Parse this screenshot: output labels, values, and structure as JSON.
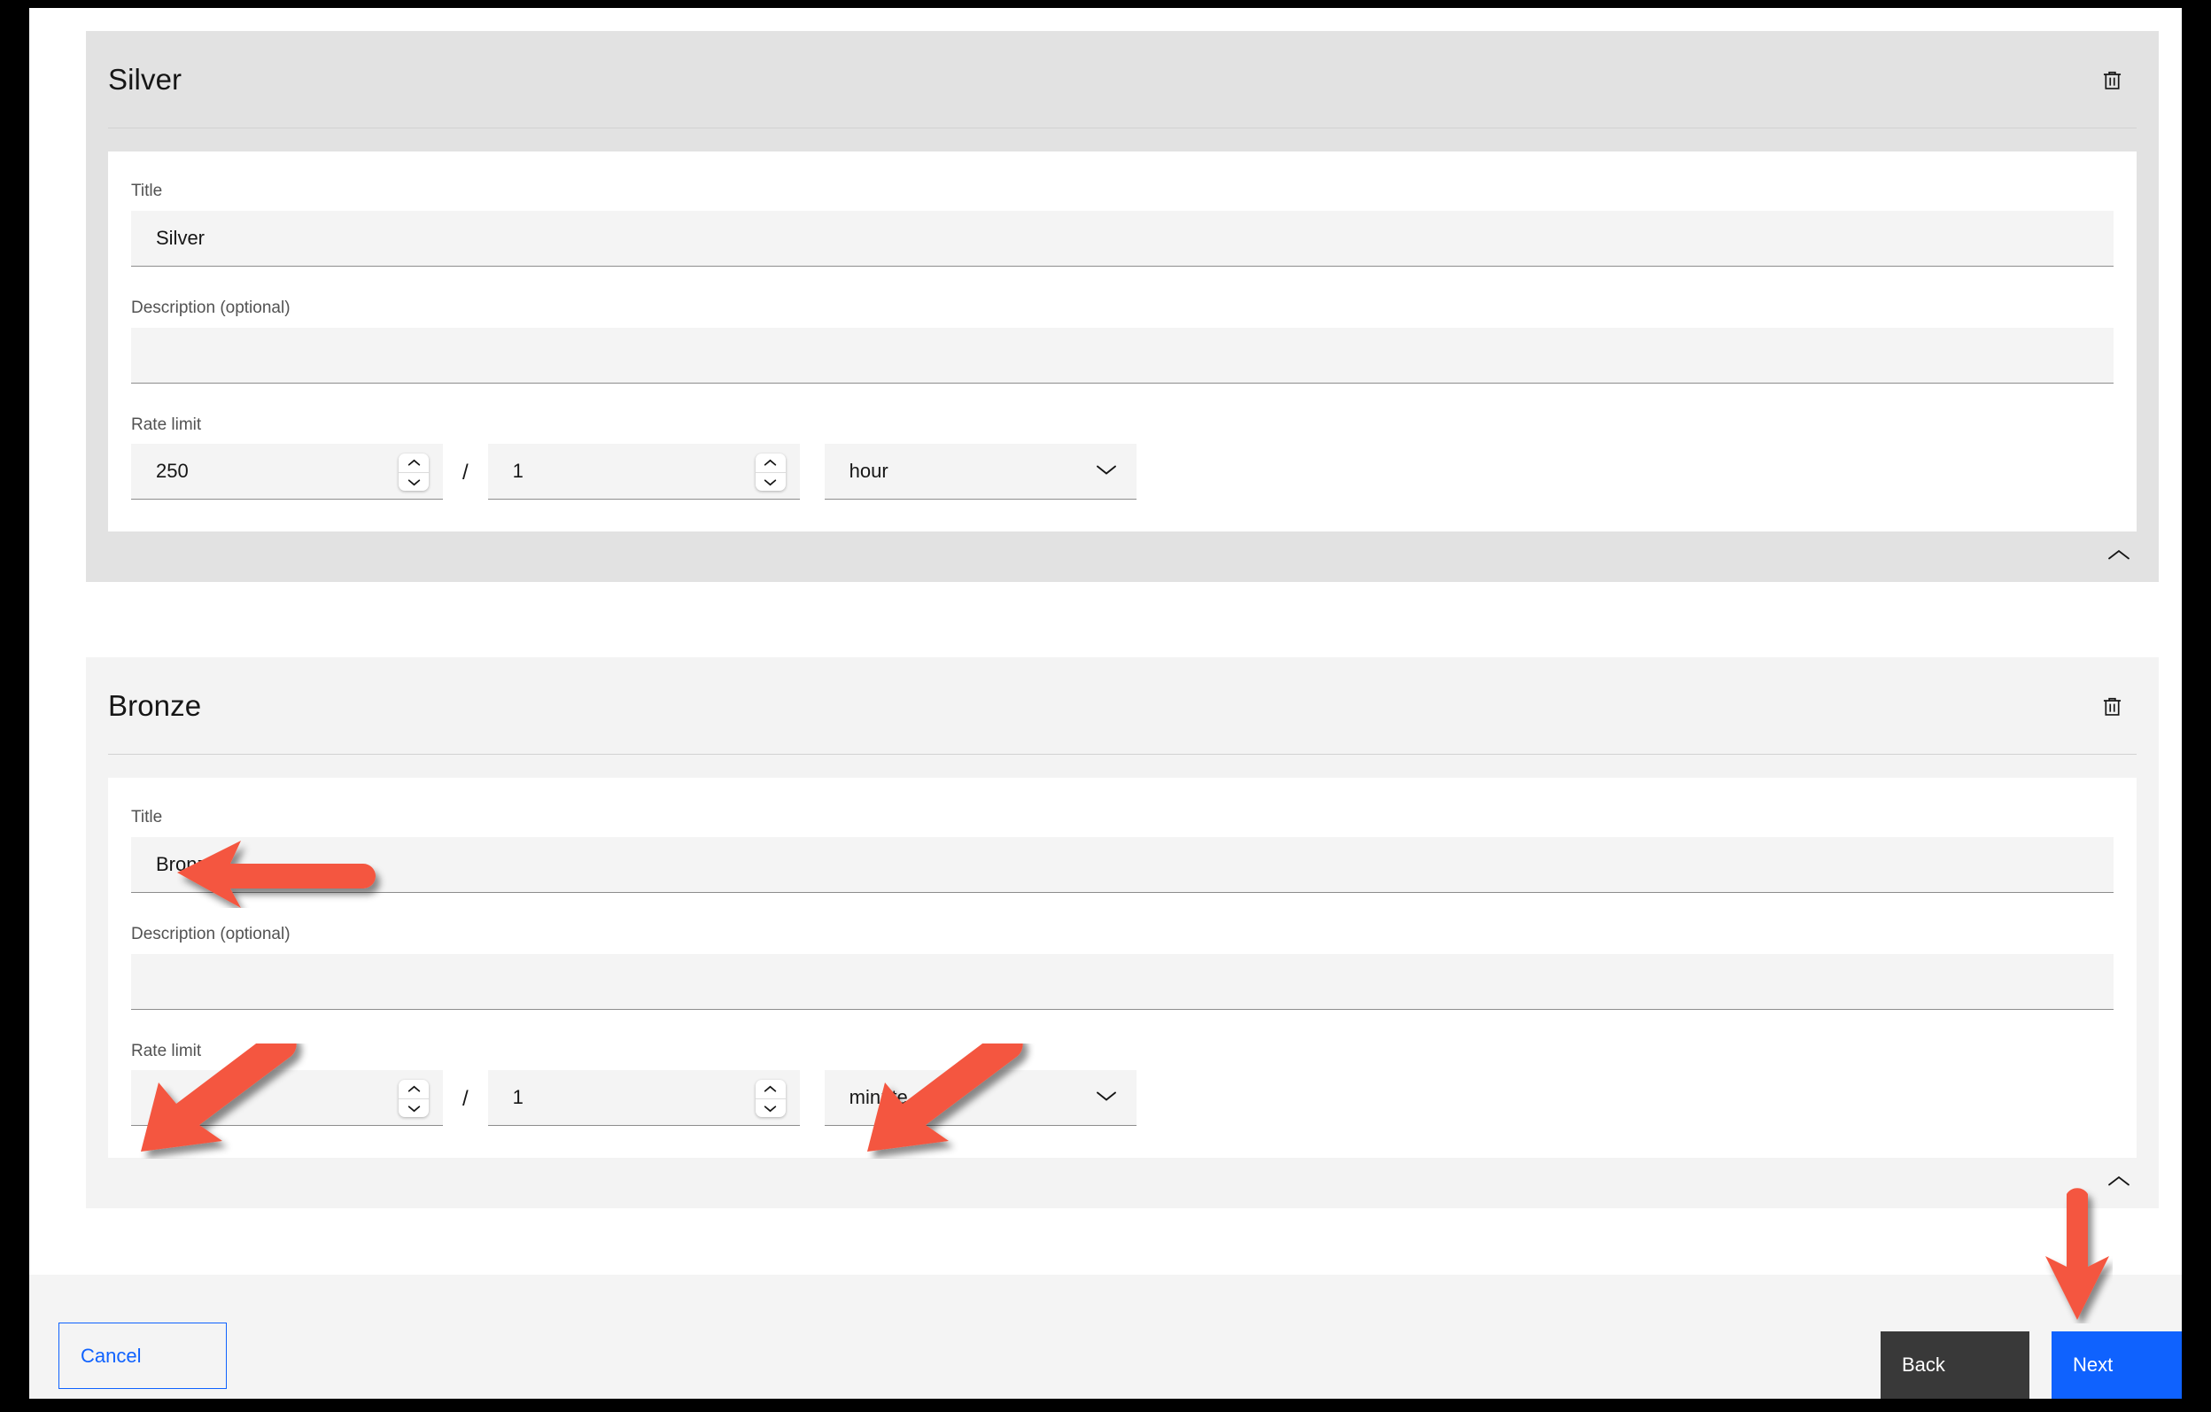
{
  "tiers": [
    {
      "name": "Silver",
      "delete_icon": "trash-icon",
      "collapse_icon": "chevron-up-icon",
      "fields": {
        "title_label": "Title",
        "title_value": "Silver",
        "description_label": "Description (optional)",
        "description_value": "",
        "description_placeholder": "",
        "rate_limit_label": "Rate limit",
        "rate_limit_count": "250",
        "rate_limit_per": "1",
        "rate_limit_unit": "hour",
        "separator": "/"
      }
    },
    {
      "name": "Bronze",
      "delete_icon": "trash-icon",
      "collapse_icon": "chevron-up-icon",
      "fields": {
        "title_label": "Title",
        "title_value": "Bronze",
        "description_label": "Description (optional)",
        "description_value": "",
        "description_placeholder": "",
        "rate_limit_label": "Rate limit",
        "rate_limit_count": "2",
        "rate_limit_per": "1",
        "rate_limit_unit": "minute",
        "separator": "/"
      }
    }
  ],
  "footer": {
    "cancel_label": "Cancel",
    "back_label": "Back",
    "next_label": "Next"
  },
  "colors": {
    "accent_blue": "#0f62fe",
    "back_dark": "#393939",
    "annotation_red": "#f4573f",
    "field_bg": "#f4f4f4",
    "card_dark": "#e2e2e2",
    "card_light": "#f3f3f3"
  },
  "annotations": [
    {
      "name": "arrow-to-bronze-title",
      "direction": "left"
    },
    {
      "name": "arrow-to-bronze-rate-limit",
      "direction": "down-left"
    },
    {
      "name": "arrow-to-bronze-unit-select",
      "direction": "down-left"
    },
    {
      "name": "arrow-to-next-button",
      "direction": "down"
    }
  ]
}
